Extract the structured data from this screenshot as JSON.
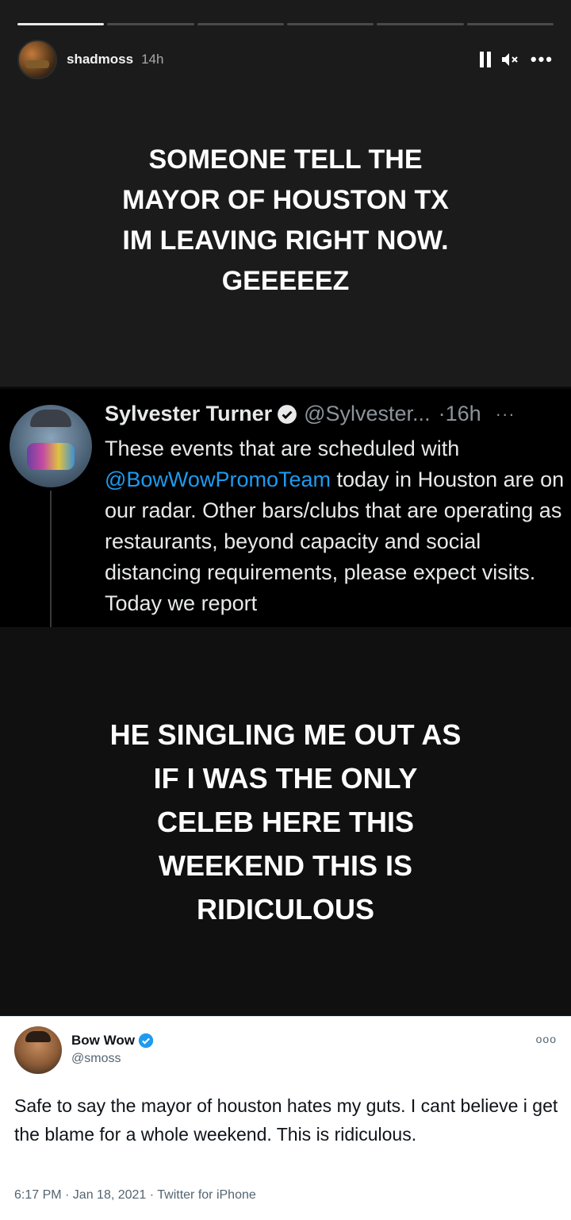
{
  "story1": {
    "progress_segments": [
      1.0,
      0,
      0,
      0,
      0,
      0
    ],
    "username": "shadmoss",
    "time": "14h",
    "text_lines": [
      "SOMEONE TELL THE",
      "MAYOR OF HOUSTON TX",
      "IM LEAVING RIGHT NOW.",
      "GEEEEEZ"
    ]
  },
  "dark_tweet": {
    "name": "Sylvester Turner",
    "handle": "@Sylvester...",
    "time": "·16h",
    "more": "···",
    "body_before": "These events that are scheduled with",
    "mention": "@BowWowPromoTeam",
    "body_after": " today in Houston are on our radar. Other bars/clubs that are operating as restaurants, beyond capacity and social distancing requirements, please expect visits. Today we report"
  },
  "story2": {
    "text_lines": [
      "HE SINGLING ME OUT AS",
      "IF I WAS THE ONLY",
      "CELEB HERE THIS",
      "WEEKEND THIS IS",
      "RIDICULOUS"
    ]
  },
  "light_tweet": {
    "name": "Bow Wow",
    "handle": "@smoss",
    "more": "ooo",
    "body": "Safe to say the mayor of houston hates my guts. I cant believe i get the blame for a whole weekend. This is ridiculous.",
    "meta": "6:17 PM · Jan 18, 2021 · Twitter for iPhone"
  },
  "colors": {
    "verified": "#1d9bf0",
    "mention": "#1d9bf0"
  }
}
